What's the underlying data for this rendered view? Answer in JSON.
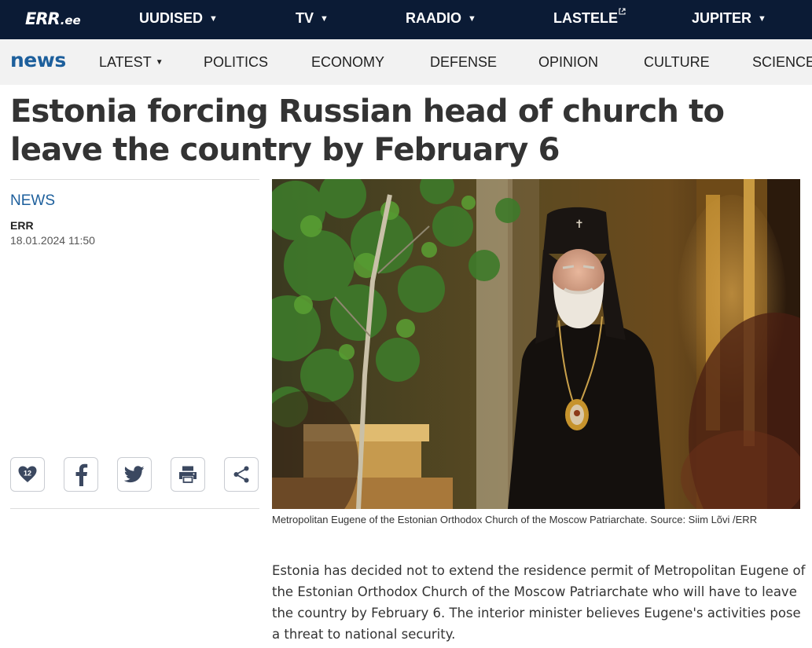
{
  "top_nav": {
    "logo_main": "ERR",
    "logo_sub": ".ee",
    "items": [
      {
        "label": "UUDISED",
        "dropdown": true
      },
      {
        "label": "TV",
        "dropdown": true
      },
      {
        "label": "RAADIO",
        "dropdown": true
      },
      {
        "label": "LASTELE",
        "external": true
      },
      {
        "label": "JUPITER",
        "dropdown": true
      }
    ]
  },
  "section_nav": {
    "brand": "news",
    "items": [
      "LATEST",
      "POLITICS",
      "ECONOMY",
      "DEFENSE",
      "OPINION",
      "CULTURE",
      "SCIENCE"
    ]
  },
  "article": {
    "headline": "Estonia forcing Russian head of church to leave the country by February 6",
    "category": "NEWS",
    "author": "ERR",
    "datetime": "18.01.2024 11:50",
    "likes": "12",
    "image_caption": "Metropolitan Eugene of the Estonian Orthodox Church of the Moscow Patriarchate. Source: Siim Lõvi /ERR",
    "lead": "Estonia has decided not to extend the residence permit of Metropolitan Eugene of the Estonian Orthodox Church of the Moscow Patriarchate who will have to leave the country by February 6. The interior minister believes Eugene's activities pose a threat to national security."
  },
  "share_buttons": [
    "heart-icon",
    "facebook-icon",
    "twitter-icon",
    "print-icon",
    "share-icon"
  ],
  "colors": {
    "top_bar": "#0b1b35",
    "brand_blue": "#1d5f9c",
    "subnav_bg": "#f2f2f2"
  }
}
